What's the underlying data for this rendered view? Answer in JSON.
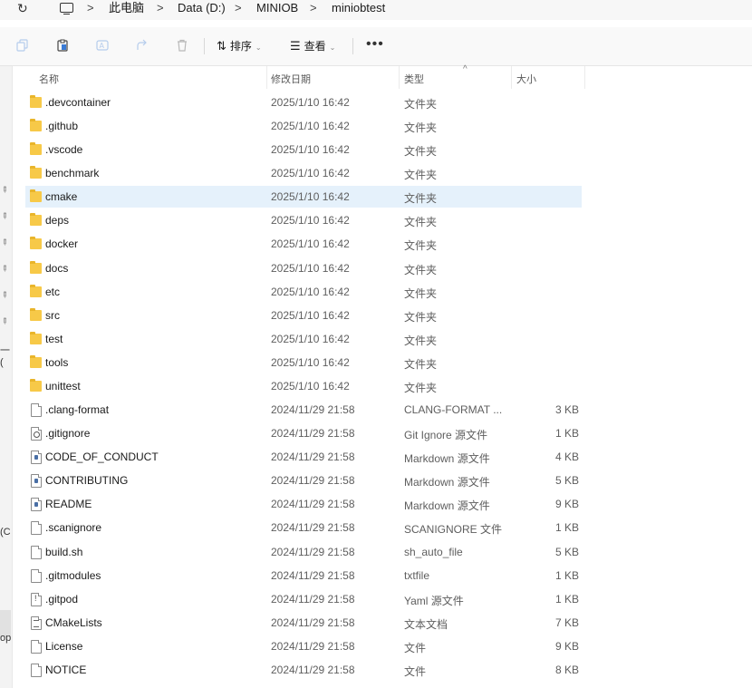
{
  "address": {
    "crumbs": [
      "此电脑",
      "Data (D:)",
      "MINIOB",
      "miniobtest"
    ],
    "separator": ">",
    "refresh_glyph": "↻"
  },
  "toolbar": {
    "sort_label": "排序",
    "view_label": "查看",
    "more_label": "•••",
    "chevron": "⌄",
    "icons": [
      "copy-icon",
      "paste-icon",
      "rename-icon",
      "share-icon",
      "delete-icon"
    ]
  },
  "leftpane": {
    "frag_1": "一(",
    "frag_2": "(C",
    "frag_3": "op"
  },
  "header": {
    "name": "名称",
    "date": "修改日期",
    "type": "类型",
    "size": "大小",
    "sort_caret": "^"
  },
  "files": [
    {
      "name": ".devcontainer",
      "date": "2025/1/10 16:42",
      "type": "文件夹",
      "size": "",
      "icon": "folder"
    },
    {
      "name": ".github",
      "date": "2025/1/10 16:42",
      "type": "文件夹",
      "size": "",
      "icon": "folder"
    },
    {
      "name": ".vscode",
      "date": "2025/1/10 16:42",
      "type": "文件夹",
      "size": "",
      "icon": "folder"
    },
    {
      "name": "benchmark",
      "date": "2025/1/10 16:42",
      "type": "文件夹",
      "size": "",
      "icon": "folder"
    },
    {
      "name": "cmake",
      "date": "2025/1/10 16:42",
      "type": "文件夹",
      "size": "",
      "icon": "folder",
      "selected": true
    },
    {
      "name": "deps",
      "date": "2025/1/10 16:42",
      "type": "文件夹",
      "size": "",
      "icon": "folder"
    },
    {
      "name": "docker",
      "date": "2025/1/10 16:42",
      "type": "文件夹",
      "size": "",
      "icon": "folder"
    },
    {
      "name": "docs",
      "date": "2025/1/10 16:42",
      "type": "文件夹",
      "size": "",
      "icon": "folder"
    },
    {
      "name": "etc",
      "date": "2025/1/10 16:42",
      "type": "文件夹",
      "size": "",
      "icon": "folder"
    },
    {
      "name": "src",
      "date": "2025/1/10 16:42",
      "type": "文件夹",
      "size": "",
      "icon": "folder"
    },
    {
      "name": "test",
      "date": "2025/1/10 16:42",
      "type": "文件夹",
      "size": "",
      "icon": "folder"
    },
    {
      "name": "tools",
      "date": "2025/1/10 16:42",
      "type": "文件夹",
      "size": "",
      "icon": "folder"
    },
    {
      "name": "unittest",
      "date": "2025/1/10 16:42",
      "type": "文件夹",
      "size": "",
      "icon": "folder"
    },
    {
      "name": ".clang-format",
      "date": "2024/11/29 21:58",
      "type": "CLANG-FORMAT ...",
      "size": "3 KB",
      "icon": "file"
    },
    {
      "name": ".gitignore",
      "date": "2024/11/29 21:58",
      "type": "Git Ignore 源文件",
      "size": "1 KB",
      "icon": "git"
    },
    {
      "name": "CODE_OF_CONDUCT",
      "date": "2024/11/29 21:58",
      "type": "Markdown 源文件",
      "size": "4 KB",
      "icon": "markdown"
    },
    {
      "name": "CONTRIBUTING",
      "date": "2024/11/29 21:58",
      "type": "Markdown 源文件",
      "size": "5 KB",
      "icon": "markdown"
    },
    {
      "name": "README",
      "date": "2024/11/29 21:58",
      "type": "Markdown 源文件",
      "size": "9 KB",
      "icon": "markdown"
    },
    {
      "name": ".scanignore",
      "date": "2024/11/29 21:58",
      "type": "SCANIGNORE 文件",
      "size": "1 KB",
      "icon": "file"
    },
    {
      "name": "build.sh",
      "date": "2024/11/29 21:58",
      "type": "sh_auto_file",
      "size": "5 KB",
      "icon": "file"
    },
    {
      "name": ".gitmodules",
      "date": "2024/11/29 21:58",
      "type": "txtfile",
      "size": "1 KB",
      "icon": "file"
    },
    {
      "name": ".gitpod",
      "date": "2024/11/29 21:58",
      "type": "Yaml 源文件",
      "size": "1 KB",
      "icon": "yaml"
    },
    {
      "name": "CMakeLists",
      "date": "2024/11/29 21:58",
      "type": "文本文档",
      "size": "7 KB",
      "icon": "text"
    },
    {
      "name": "License",
      "date": "2024/11/29 21:58",
      "type": "文件",
      "size": "9 KB",
      "icon": "file"
    },
    {
      "name": "NOTICE",
      "date": "2024/11/29 21:58",
      "type": "文件",
      "size": "8 KB",
      "icon": "file"
    }
  ]
}
